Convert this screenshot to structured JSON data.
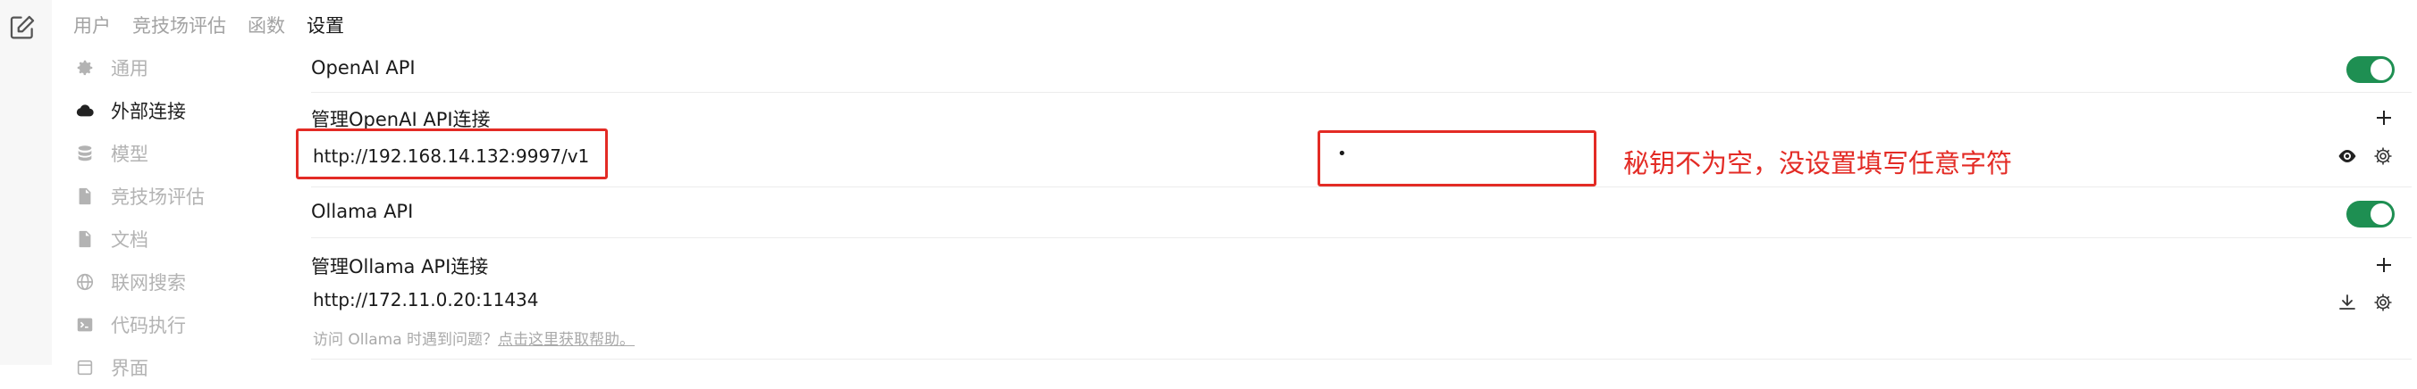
{
  "header": {
    "tabs": [
      {
        "label": "用户"
      },
      {
        "label": "竞技场评估"
      },
      {
        "label": "函数"
      },
      {
        "label": "设置"
      }
    ]
  },
  "sidebar": {
    "items": [
      {
        "label": "通用",
        "icon": "gear-icon"
      },
      {
        "label": "外部连接",
        "icon": "cloud-icon",
        "active": true
      },
      {
        "label": "模型",
        "icon": "database-icon"
      },
      {
        "label": "竞技场评估",
        "icon": "document-icon"
      },
      {
        "label": "文档",
        "icon": "document-icon"
      },
      {
        "label": "联网搜索",
        "icon": "globe-icon"
      },
      {
        "label": "代码执行",
        "icon": "terminal-icon"
      },
      {
        "label": "界面",
        "icon": "interface-icon"
      }
    ]
  },
  "openai": {
    "title": "OpenAI API",
    "enabled": true,
    "manage_label": "管理OpenAI API连接",
    "url": "http://192.168.14.132:9997/v1",
    "key_value": "•"
  },
  "annotation": {
    "note": "秘钥不为空，没设置填写任意字符",
    "color": "#e32b25"
  },
  "ollama": {
    "title": "Ollama API",
    "enabled": true,
    "manage_label": "管理Ollama API连接",
    "url": "http://172.11.0.20:11434",
    "help_prefix": "访问 Ollama 时遇到问题？",
    "help_link": "点击这里获取帮助。"
  },
  "colors": {
    "toggle_on": "#1e8f52",
    "accent_red": "#e32b25"
  }
}
